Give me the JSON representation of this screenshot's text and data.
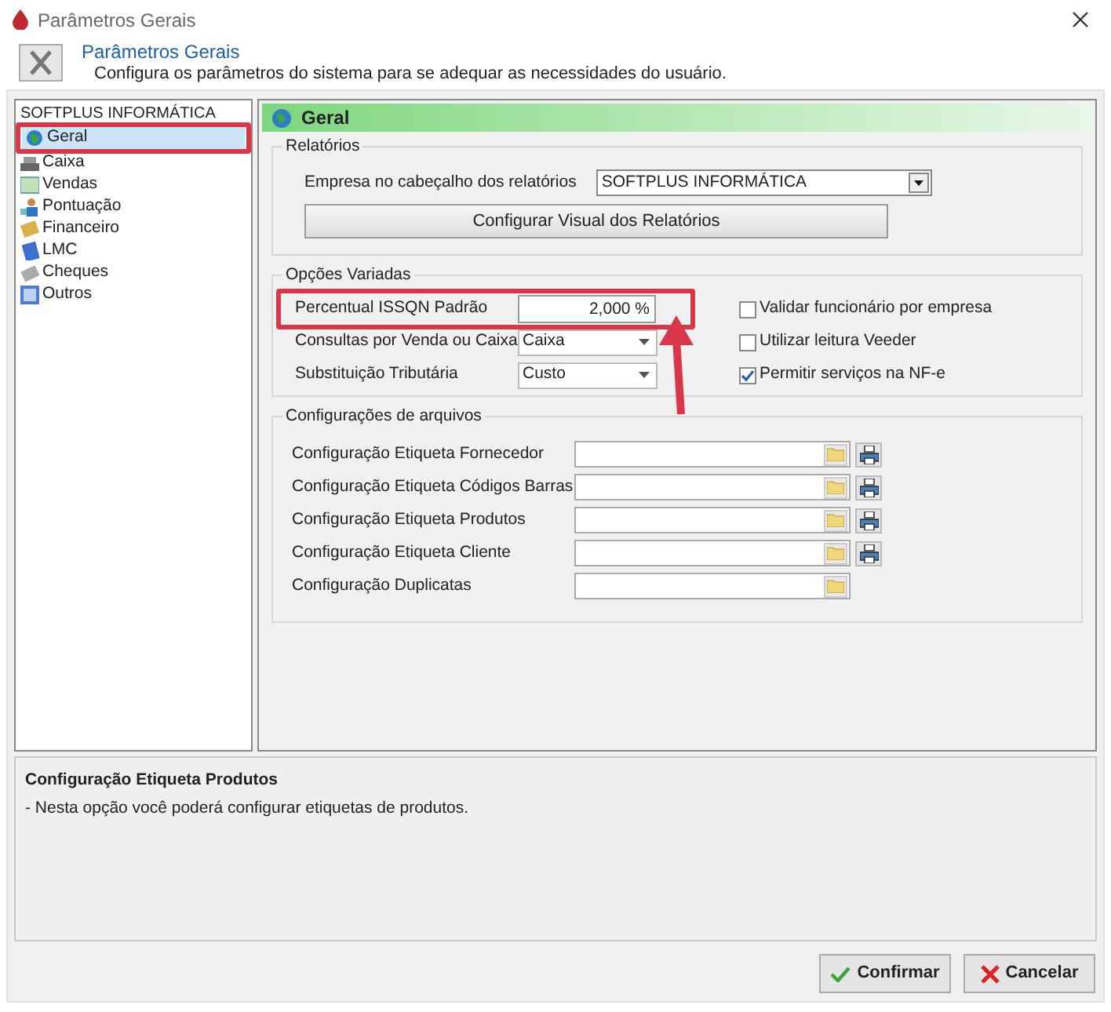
{
  "window": {
    "title": "Parâmetros Gerais"
  },
  "header": {
    "title": "Parâmetros Gerais",
    "subtitle": "Configura os parâmetros do sistema para se adequar as necessidades do usuário."
  },
  "tree": {
    "root": "SOFTPLUS INFORMÁTICA",
    "items": [
      {
        "label": "Geral",
        "selected": true
      },
      {
        "label": "Caixa",
        "selected": false
      },
      {
        "label": "Vendas",
        "selected": false
      },
      {
        "label": "Pontuação",
        "selected": false
      },
      {
        "label": "Financeiro",
        "selected": false
      },
      {
        "label": "LMC",
        "selected": false
      },
      {
        "label": "Cheques",
        "selected": false
      },
      {
        "label": "Outros",
        "selected": false
      }
    ]
  },
  "section_title": "Geral",
  "relatorios": {
    "title": "Relatórios",
    "empresa_label": "Empresa no cabeçalho dos relatórios",
    "empresa_value": "SOFTPLUS INFORMÁTICA",
    "button": "Configurar Visual dos Relatórios"
  },
  "opcoes": {
    "title": "Opções Variadas",
    "fields": [
      {
        "label": "Percentual ISSQN Padrão",
        "value": "2,000 %",
        "kind": "text"
      },
      {
        "label": "Consultas por Venda ou Caixa",
        "value": "Caixa",
        "kind": "select"
      },
      {
        "label": "Substituição Tributária",
        "value": "Custo",
        "kind": "select"
      }
    ],
    "checkboxes": [
      {
        "label": "Validar funcionário por empresa",
        "checked": false
      },
      {
        "label": "Utilizar leitura Veeder",
        "checked": false
      },
      {
        "label": "Permitir serviços na NF-e",
        "checked": true
      }
    ]
  },
  "arquivos": {
    "title": "Configurações de arquivos",
    "rows": [
      {
        "label": "Configuração Etiqueta Fornecedor",
        "printable": true
      },
      {
        "label": "Configuração Etiqueta Códigos Barras",
        "printable": true
      },
      {
        "label": "Configuração Etiqueta Produtos",
        "printable": true
      },
      {
        "label": "Configuração Etiqueta Cliente",
        "printable": true
      },
      {
        "label": "Configuração Duplicatas",
        "printable": false
      }
    ]
  },
  "description": {
    "title": "Configuração Etiqueta Produtos",
    "text": "- Nesta opção você poderá configurar etiquetas de produtos."
  },
  "buttons": [
    {
      "label": "Confirmar",
      "kind": "confirm"
    },
    {
      "label": "Cancelar",
      "kind": "cancel"
    }
  ]
}
